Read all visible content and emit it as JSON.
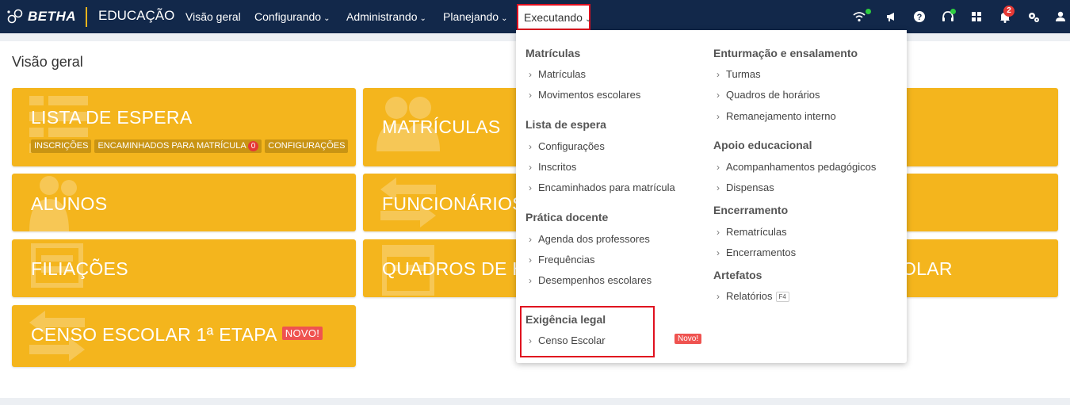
{
  "brand": {
    "logo_text": "BETHA",
    "app_name": "EDUCAÇÃO"
  },
  "nav": {
    "items": [
      {
        "label": "Visão geral"
      },
      {
        "label": "Configurando"
      },
      {
        "label": "Administrando"
      },
      {
        "label": "Planejando"
      }
    ],
    "active": {
      "label": "Executando"
    },
    "chevron": "⌄"
  },
  "toolbar": {
    "icons": [
      "wifi-icon",
      "megaphone-icon",
      "help-icon",
      "headset-icon",
      "apps-grid-icon",
      "bell-icon",
      "settings-icon",
      "user-icon"
    ],
    "notification_count": "2"
  },
  "page": {
    "title": "Visão geral"
  },
  "cards": {
    "lista": {
      "title": "LISTA DE ESPERA",
      "chips": {
        "inscricoes": "INSCRIÇÕES",
        "encaminhados": "ENCAMINHADOS PARA MATRÍCULA",
        "encaminhados_count": "0",
        "config": "CONFIGURAÇÕES"
      }
    },
    "matriculas": {
      "title": "MATRÍCULAS"
    },
    "alunos": {
      "title": "ALUNOS"
    },
    "funcionarios": {
      "title": "FUNCIONÁRIOS"
    },
    "filiacoes": {
      "title": "FILIAÇÕES"
    },
    "quadros": {
      "title": "QUADROS DE H"
    },
    "censo_right": {
      "title": "OLAR"
    },
    "censo": {
      "title": "CENSO ESCOLAR 1ª ETAPA",
      "tag": "NOVO!"
    }
  },
  "dropdown": {
    "left": {
      "matriculas": {
        "title": "Matrículas",
        "items": [
          "Matrículas",
          "Movimentos escolares"
        ]
      },
      "lista": {
        "title": "Lista de espera",
        "items": [
          "Configurações",
          "Inscritos",
          "Encaminhados para matrícula"
        ]
      },
      "pratica": {
        "title": "Prática docente",
        "items": [
          "Agenda dos professores",
          "Frequências",
          "Desempenhos escolares"
        ]
      },
      "exigencia": {
        "title": "Exigência legal",
        "items": [
          "Censo Escolar"
        ],
        "tag": "Novo!"
      }
    },
    "right": {
      "enturmacao": {
        "title": "Enturmação e ensalamento",
        "items": [
          "Turmas",
          "Quadros de horários",
          "Remanejamento interno"
        ]
      },
      "apoio": {
        "title": "Apoio educacional",
        "items": [
          "Acompanhamentos pedagógicos",
          "Dispensas"
        ]
      },
      "encerramento": {
        "title": "Encerramento",
        "items": [
          "Rematrículas",
          "Encerramentos"
        ]
      },
      "artefatos": {
        "title": "Artefatos",
        "items": [
          "Relatórios"
        ],
        "shortcut": "F4"
      }
    },
    "arrow": "›"
  },
  "colors": {
    "topbar": "#12284a",
    "card": "#f4b51d",
    "accent": "#f1b51c",
    "highlight": "#e0101f"
  }
}
